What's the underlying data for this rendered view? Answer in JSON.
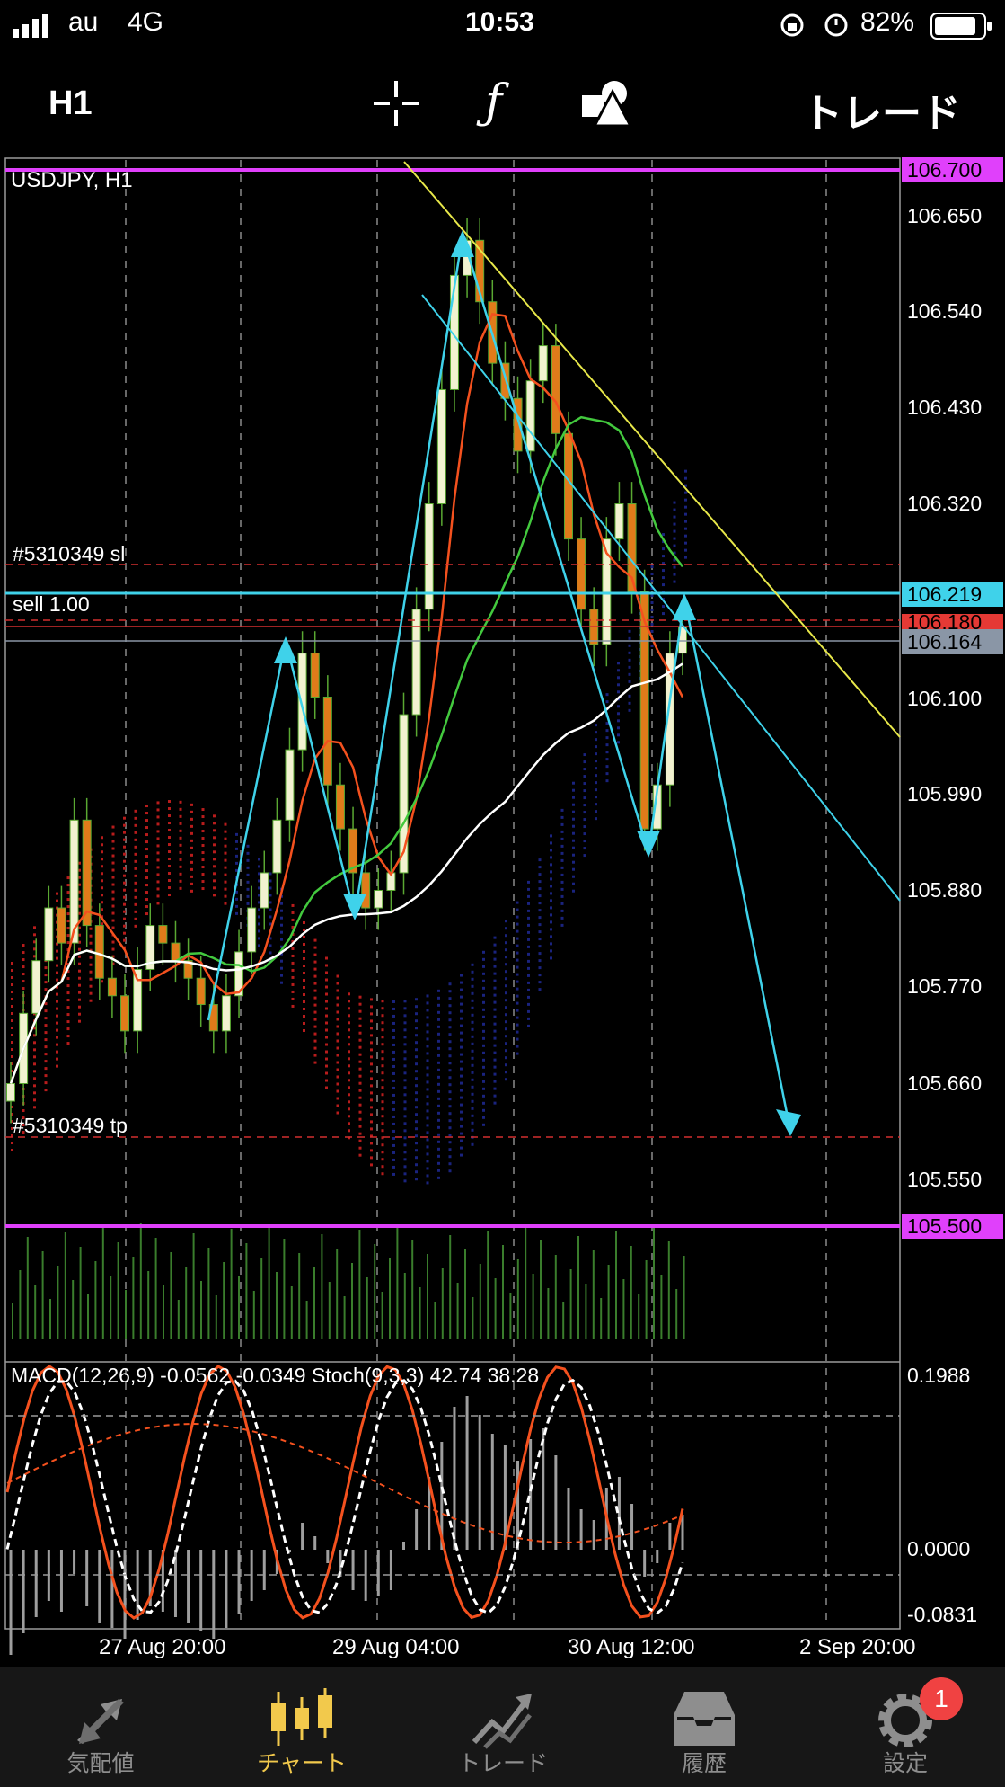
{
  "status_bar": {
    "carrier": "au",
    "network": "4G",
    "time": "10:53",
    "battery": "82%"
  },
  "toolbar": {
    "timeframe": "H1",
    "trade_label": "トレード",
    "crosshair_icon": "crosshair-icon",
    "indicator_icon": "function-icon",
    "objects_icon": "shapes-icon"
  },
  "chart": {
    "symbol_label": "USDJPY, H1",
    "sl_label": "#5310349 sl",
    "sell_label": "sell 1.00",
    "tp_label": "#5310349 tp",
    "price_scale": [
      "106.650",
      "106.540",
      "106.430",
      "106.320",
      "106.100",
      "105.990",
      "105.880",
      "105.770",
      "105.660",
      "105.550"
    ],
    "price_tags": [
      {
        "text": "106.700",
        "color": "#e040fb"
      },
      {
        "text": "106.219",
        "color": "#3fd2ea"
      },
      {
        "text": "106.180",
        "color": "#e53935"
      },
      {
        "text": "106.164",
        "color": "#8a96a6"
      },
      {
        "text": "105.500",
        "color": "#e040fb"
      }
    ],
    "macd_label": "MACD(12,26,9) -0.0562 -0.0349 Stoch(9,3,3) 42.74 38.28",
    "macd_scale": [
      "0.1988",
      "0.0000",
      "-0.0831"
    ],
    "time_labels": [
      "27 Aug 20:00",
      "29 Aug 04:00",
      "30 Aug 12:00",
      "2 Sep 20:00"
    ]
  },
  "chart_data": {
    "type": "candlestick",
    "title": "USDJPY, H1",
    "ylim": [
      105.48,
      106.72
    ],
    "indicators": [
      "MACD(12,26,9)",
      "Stoch(9,3,3)"
    ],
    "horizontal_lines": [
      106.7,
      106.219,
      106.18,
      106.164,
      105.5
    ],
    "closes": [
      105.66,
      105.74,
      105.8,
      105.86,
      105.82,
      105.96,
      105.84,
      105.78,
      105.76,
      105.72,
      105.79,
      105.84,
      105.82,
      105.8,
      105.78,
      105.75,
      105.72,
      105.76,
      105.81,
      105.86,
      105.9,
      105.96,
      106.04,
      106.15,
      106.1,
      106.0,
      105.95,
      105.9,
      105.86,
      105.88,
      105.9,
      106.08,
      106.2,
      106.32,
      106.45,
      106.58,
      106.62,
      106.55,
      106.48,
      106.44,
      106.38,
      106.46,
      106.5,
      106.4,
      106.28,
      106.2,
      106.16,
      106.28,
      106.32,
      106.22,
      105.95,
      106.0,
      106.15,
      106.18
    ]
  },
  "nav": {
    "items": [
      {
        "label": "気配値",
        "icon": "quotes-icon"
      },
      {
        "label": "チャート",
        "icon": "chart-icon"
      },
      {
        "label": "トレード",
        "icon": "trade-icon"
      },
      {
        "label": "履歴",
        "icon": "history-icon"
      },
      {
        "label": "設定",
        "icon": "settings-icon"
      }
    ],
    "badge": "1"
  }
}
